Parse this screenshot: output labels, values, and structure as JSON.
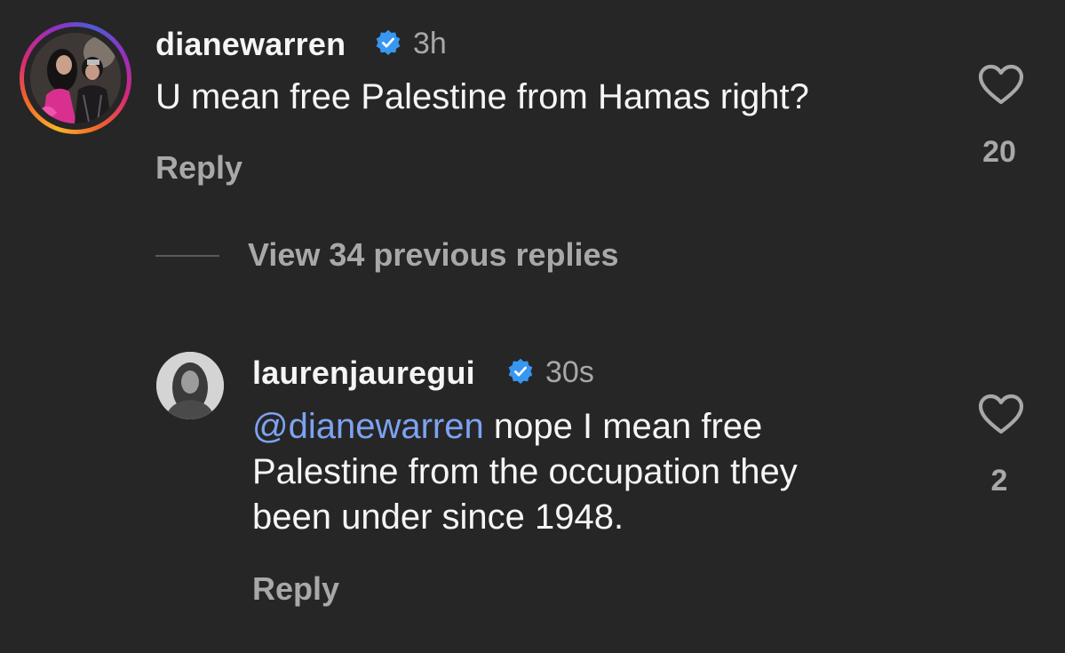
{
  "comments": [
    {
      "username": "dianewarren",
      "verified": true,
      "timestamp": "3h",
      "text": "U mean free Palestine from Hamas right?",
      "reply_label": "Reply",
      "likes": "20",
      "avatar_ring": true
    },
    {
      "username": "laurenjauregui",
      "verified": true,
      "timestamp": "30s",
      "mention": "@dianewarren",
      "text_line1": " nope I mean free",
      "text_line2": "Palestine from the occupation they",
      "text_line3": "been under since 1948.",
      "reply_label": "Reply",
      "likes": "2"
    }
  ],
  "view_replies_label": "View 34 previous replies",
  "colors": {
    "background": "#262626",
    "primary_text": "#f5f5f5",
    "secondary_text": "#a8a8a8",
    "verified_blue": "#3897f0",
    "mention_blue": "#7da2f2"
  },
  "icons": {
    "verified": "verified-badge-icon",
    "like": "heart-outline-icon"
  }
}
